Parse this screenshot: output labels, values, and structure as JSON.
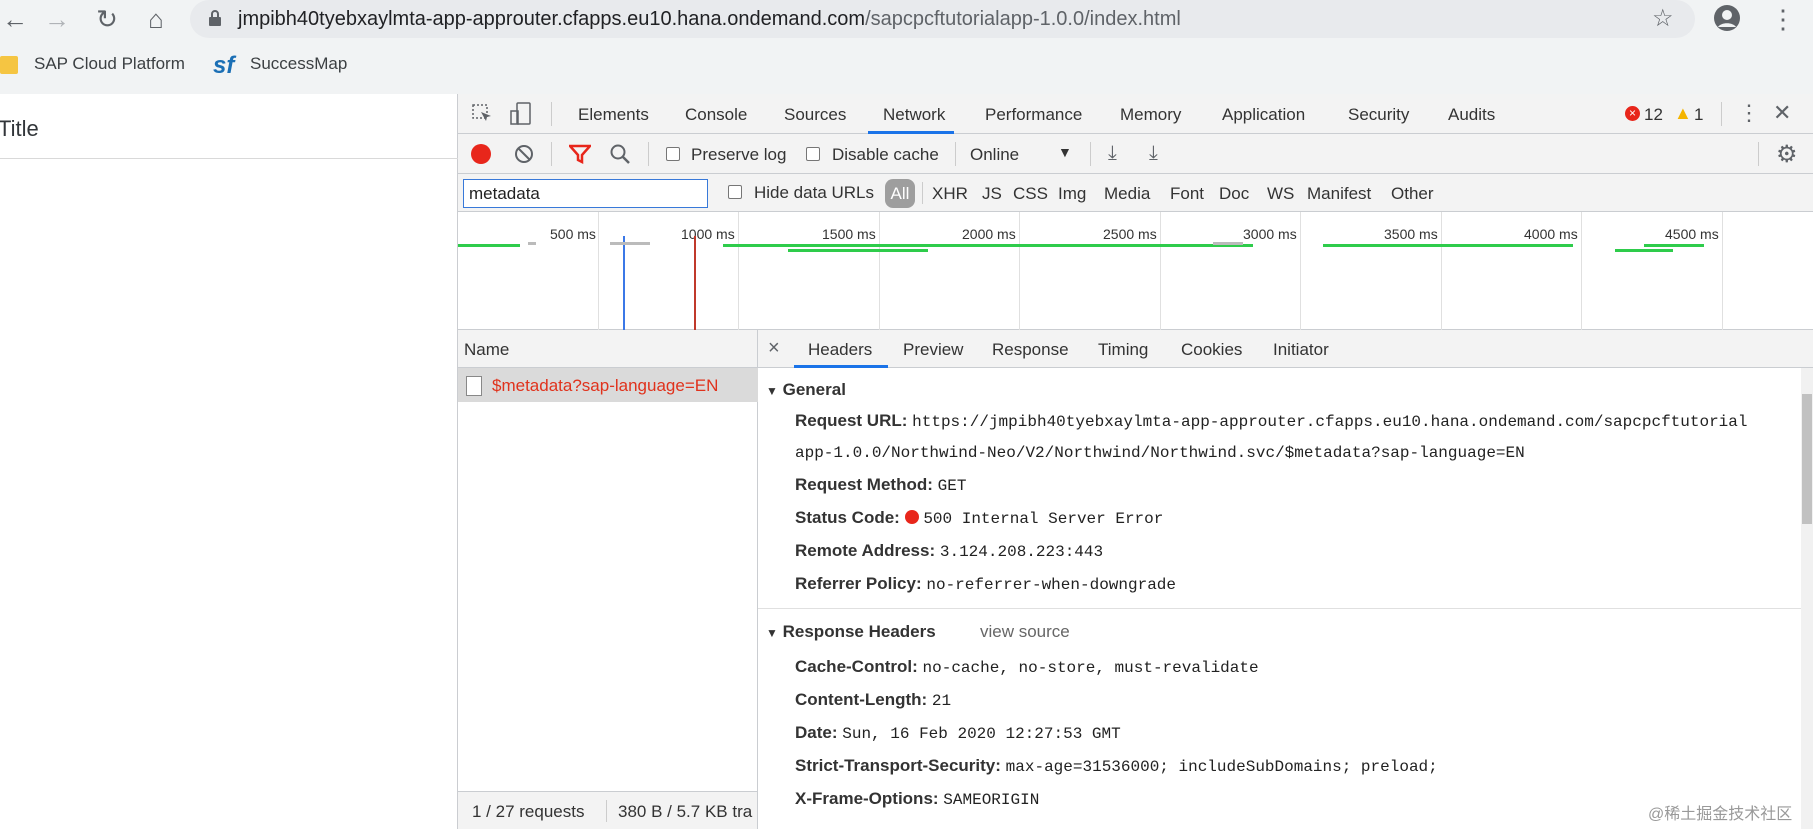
{
  "browser": {
    "url_host": "jmpibh40tyebxaylmta-app-approuter.cfapps.eu10.hana.ondemand.com",
    "url_path": "/sapcpcftutorialapp-1.0.0/index.html",
    "bookmarks": [
      "SAP Cloud Platform",
      "SuccessMap"
    ],
    "icons": [
      "back-arrow-icon",
      "forward-arrow-icon",
      "reload-icon",
      "home-icon",
      "lock-icon",
      "star-icon",
      "account-icon",
      "kebab-menu-icon"
    ]
  },
  "page": {
    "title": "Title"
  },
  "devtools": {
    "tabs": [
      "Elements",
      "Console",
      "Sources",
      "Network",
      "Performance",
      "Memory",
      "Application",
      "Security",
      "Audits"
    ],
    "active_tab": "Network",
    "error_count": "12",
    "warning_count": "1",
    "toolbar": {
      "preserve_log": "Preserve log",
      "disable_cache": "Disable cache",
      "throttle": "Online"
    },
    "filter": {
      "value": "metadata",
      "hide_data_urls": "Hide data URLs",
      "types": [
        "All",
        "XHR",
        "JS",
        "CSS",
        "Img",
        "Media",
        "Font",
        "Doc",
        "WS",
        "Manifest",
        "Other"
      ],
      "active_type": "All"
    },
    "timeline_ticks": [
      "500 ms",
      "1000 ms",
      "1500 ms",
      "2000 ms",
      "2500 ms",
      "3000 ms",
      "3500 ms",
      "4000 ms",
      "4500 ms"
    ],
    "name_header": "Name",
    "requests": [
      "$metadata?sap-language=EN"
    ],
    "status": {
      "requests": "1 / 27 requests",
      "transferred": "380 B / 5.7 KB tra"
    },
    "detail_tabs": [
      "Headers",
      "Preview",
      "Response",
      "Timing",
      "Cookies",
      "Initiator"
    ],
    "active_detail_tab": "Headers",
    "general": {
      "title": "General",
      "request_url_label": "Request URL:",
      "request_url_line1": "https://jmpibh40tyebxaylmta-app-approuter.cfapps.eu10.hana.ondemand.com/sapcpcftutorial",
      "request_url_line2": "app-1.0.0/Northwind-Neo/V2/Northwind/Northwind.svc/$metadata?sap-language=EN",
      "method_label": "Request Method:",
      "method": "GET",
      "status_label": "Status Code:",
      "status": "500 Internal Server Error",
      "status_color": "#e8261b",
      "remote_label": "Remote Address:",
      "remote": "3.124.208.223:443",
      "referrer_label": "Referrer Policy:",
      "referrer": "no-referrer-when-downgrade"
    },
    "response_headers": {
      "title": "Response Headers",
      "view_source": "view source",
      "items": [
        {
          "k": "Cache-Control:",
          "v": "no-cache, no-store, must-revalidate"
        },
        {
          "k": "Content-Length:",
          "v": "21"
        },
        {
          "k": "Date:",
          "v": "Sun, 16 Feb 2020 12:27:53 GMT"
        },
        {
          "k": "Strict-Transport-Security:",
          "v": "max-age=31536000; includeSubDomains; preload;"
        },
        {
          "k": "X-Frame-Options:",
          "v": "SAMEORIGIN"
        }
      ]
    }
  },
  "watermark": "@稀土掘金技术社区",
  "colors": {
    "accent": "#1a73e8",
    "error": "#e8261b",
    "record": "#e8261b",
    "filter_active": "#e8261b"
  }
}
